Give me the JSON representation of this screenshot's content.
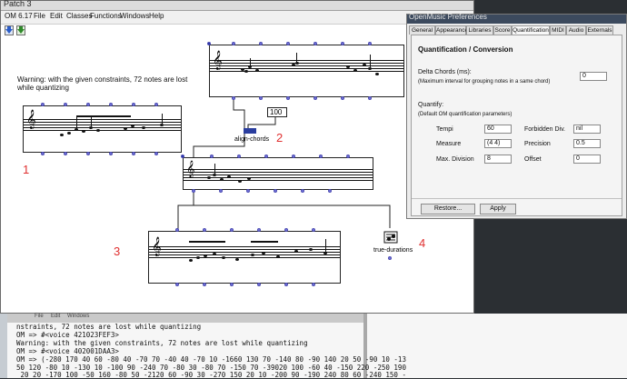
{
  "patch": {
    "title": "Patch 3",
    "menu": [
      "OM 6.17",
      "File",
      "Edit",
      "Classes",
      "Functions",
      "Windows",
      "Help"
    ],
    "warning": "Warning: with the given constraints, 72 notes are lost while quantizing",
    "align_label": "align-chords",
    "number_box": "100",
    "true_durations_label": "true-durations",
    "markers": [
      "1",
      "2",
      "3",
      "4"
    ]
  },
  "prefs": {
    "title": "OpenMusic Preferences",
    "tabs": [
      "General",
      "Appearance",
      "Libraries",
      "Score",
      "Quantification",
      "MIDI",
      "Audio",
      "Externals"
    ],
    "heading": "Quantification / Conversion",
    "delta_label": "Delta Chords (ms):",
    "delta_hint": "(Maximum interval for grouping notes in a same chord)",
    "delta_value": "0",
    "quantify_label": "Quantify:",
    "quantify_hint": "(Default OM quantification parameters)",
    "tempi_label": "Tempi",
    "tempi_value": "60",
    "forbidden_label": "Forbidden Div.",
    "forbidden_value": "nil",
    "measure_label": "Measure",
    "measure_value": "(4 4)",
    "precision_label": "Precision",
    "precision_value": "0.5",
    "maxdiv_label": "Max. Division",
    "maxdiv_value": "8",
    "offset_label": "Offset",
    "offset_value": "0",
    "restore_label": "Restore...",
    "apply_label": "Apply"
  },
  "console": {
    "menu": [
      "File",
      "Edit",
      "Windows"
    ],
    "lines": [
      "nstraints, 72 notes are lost while quantizing",
      "OM => #<voice 421023FEF3>",
      "Warning: with the given constraints, 72 notes are lost while quantizing",
      "OM => #<voice 402001DAA3>",
      "OM => (-280 170 40 60 -80 40 -70 70 -40 40 -70 10 -1660 130 70 -140 80 -90 140 20 50 -90 10 -13",
      "50 120 -80 10 -130 10 -100 90 -240 70 -80 30 -80 70 -150 70 -39020 100 -60 40 -150 220 -250 190",
      " 20 20 -170 100 -50 160 -80 50 -2120 60 -90 30 -270 150 20 10 -200 90 -190 240 80 60 -240 150 -"
    ]
  },
  "colors": {
    "accent_red": "#e03030",
    "inlet_blue": "#7777dd",
    "prefs_title_bg": "#3c4a5e"
  }
}
